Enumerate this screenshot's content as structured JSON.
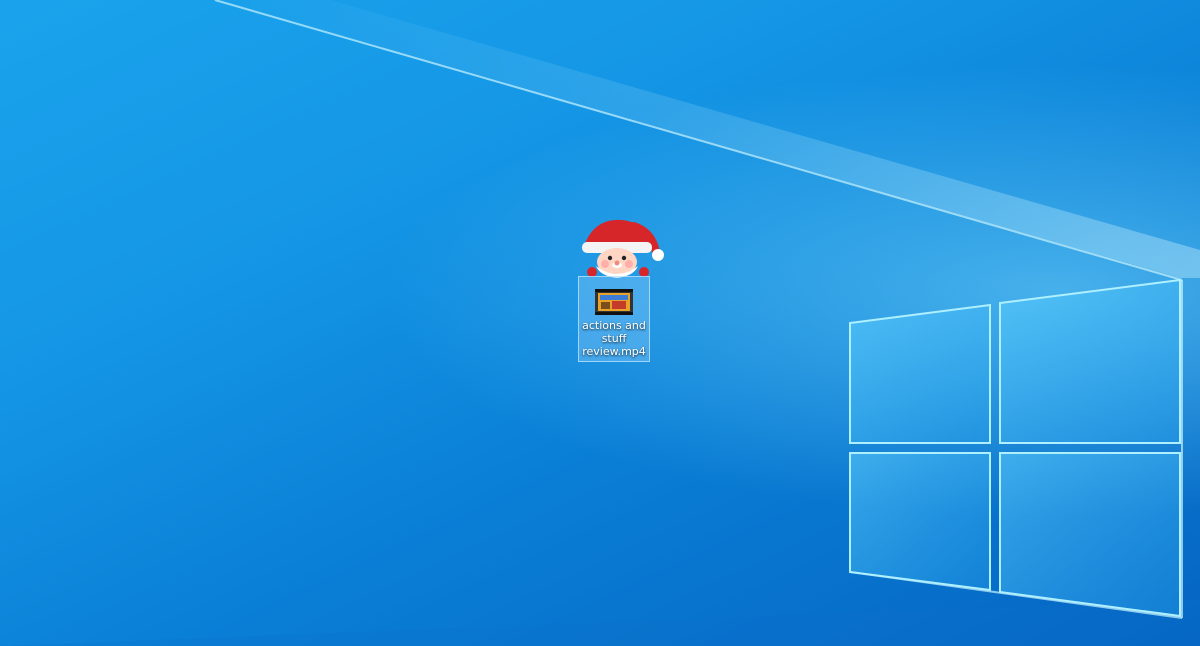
{
  "desktop": {
    "wallpaper_icon": "windows-logo-light-beams",
    "colors": {
      "background_light": "#1aa3ec",
      "background_dark": "#0565c2",
      "selection": "#96d2ff"
    },
    "icons": [
      {
        "label": "actions and stuff review.mp4",
        "icon": "video-file-icon",
        "selected": true
      }
    ],
    "decoration": {
      "icon": "santa-icon"
    }
  }
}
